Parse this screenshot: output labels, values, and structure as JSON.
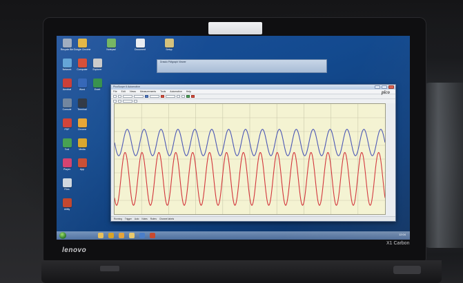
{
  "device": {
    "brand": "lenovo",
    "model": "X1 Carbon"
  },
  "desktop": {
    "icons": [
      {
        "label": "Recycle Bin",
        "icon": "recycle-bin-icon",
        "color": "#9aa8bb"
      },
      {
        "label": "Google Chrome",
        "icon": "chrome-icon",
        "color": "#e2b23a"
      },
      {
        "label": "Notepad",
        "icon": "notepad-icon",
        "color": "#6fb35c"
      },
      {
        "label": "Document",
        "icon": "document-icon",
        "color": "#e8ecf2"
      },
      {
        "label": "Setup",
        "icon": "setup-icon",
        "color": "#d3c07a"
      },
      {
        "label": "Network",
        "icon": "network-icon",
        "color": "#5a9fd4"
      },
      {
        "label": "Computer",
        "icon": "computer-icon",
        "color": "#d4452d"
      },
      {
        "label": "Explorer",
        "icon": "explorer-icon",
        "color": "#c8c8c8"
      },
      {
        "label": "Acrobat",
        "icon": "acrobat-icon",
        "color": "#c9332b"
      },
      {
        "label": "Word",
        "icon": "word-icon",
        "color": "#2b5fb4"
      },
      {
        "label": "Excel",
        "icon": "excel-icon",
        "color": "#2f8d46"
      },
      {
        "label": "Console",
        "icon": "console-icon",
        "color": "#6a7f99"
      },
      {
        "label": "Terminal",
        "icon": "terminal-icon",
        "color": "#29313d"
      },
      {
        "label": "PDF",
        "icon": "pdf-icon",
        "color": "#cf3a2e"
      },
      {
        "label": "Chrome",
        "icon": "chrome-icon",
        "color": "#e6a32e"
      },
      {
        "label": "Tool",
        "icon": "tool-icon",
        "color": "#3f9c4a"
      },
      {
        "label": "Media",
        "icon": "media-icon",
        "color": "#d8a326"
      },
      {
        "label": "Player",
        "icon": "player-icon",
        "color": "#d33b6a"
      },
      {
        "label": "App",
        "icon": "app-icon",
        "color": "#c74a2f"
      },
      {
        "label": "Files",
        "icon": "files-icon",
        "color": "#cfd6de"
      },
      {
        "label": "Utility",
        "icon": "utility-icon",
        "color": "#c14128"
      }
    ]
  },
  "taskbar": {
    "icons": [
      "explorer-icon",
      "media-icon",
      "chrome-icon",
      "folder-icon",
      "picoscope-icon",
      "app-icon"
    ],
    "tray_time": "12:04"
  },
  "background_window": {
    "title": "Drawio Pdfgraph Viewer"
  },
  "main_window": {
    "title": "PicoScope 6 Automotive",
    "menu": [
      "File",
      "Edit",
      "Views",
      "Measurements",
      "Tools",
      "Automotive",
      "Help"
    ],
    "logo": "pico",
    "status": [
      "Running",
      "Trigger",
      "Auto",
      "Notes",
      "Rulers",
      "Channel labels"
    ]
  },
  "chart_data": {
    "type": "line",
    "series": [
      {
        "color": "#4a56b5",
        "cycles": 16,
        "center": 0.35,
        "amplitude": 0.12
      },
      {
        "color": "#d2343a",
        "cycles": 16,
        "center": 0.68,
        "amplitude": 0.24
      }
    ],
    "grid": true,
    "xlabel": "",
    "ylabel": ""
  }
}
